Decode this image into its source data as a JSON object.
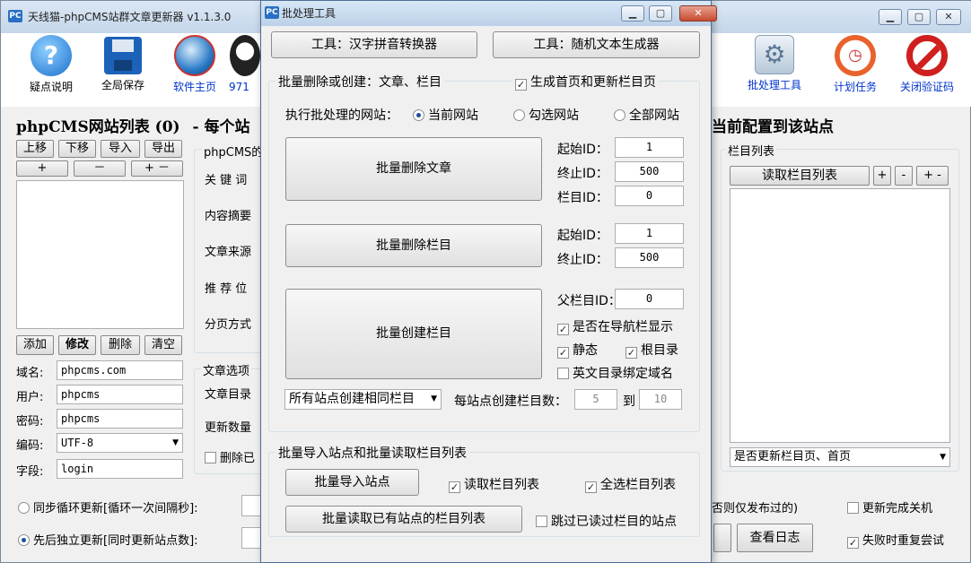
{
  "window": {
    "title": "天线猫-phpCMS站群文章更新器 v1.1.3.0",
    "icon": "PC"
  },
  "toolbar": [
    {
      "label": "疑点说明",
      "icon": "help-icon"
    },
    {
      "label": "全局保存",
      "icon": "save-disk-icon"
    },
    {
      "label": "软件主页",
      "icon": "globe-icon"
    },
    {
      "label": "971",
      "icon": "penguin-icon"
    },
    {
      "label": "批处理工具",
      "icon": "gear-cube-icon"
    },
    {
      "label": "计划任务",
      "icon": "clock-icon"
    },
    {
      "label": "关闭验证码",
      "icon": "no-entry-icon"
    }
  ],
  "left": {
    "site_list_title": "phpCMS网站列表 (0)",
    "heading_suffix": "- 每个站",
    "btn_up": "上移",
    "btn_down": "下移",
    "btn_import": "导入",
    "btn_export": "导出",
    "btn_plus": "+",
    "btn_minus": "－",
    "btn_plusminus": "+ －",
    "btn_add": "添加",
    "btn_edit": "修改",
    "btn_delete": "删除",
    "btn_clear": "清空",
    "domain_label": "域名:",
    "domain_value": "phpcms.com",
    "user_label": "用户:",
    "user_value": "phpcms",
    "pass_label": "密码:",
    "pass_value": "phpcms",
    "encoding_label": "编码:",
    "encoding_value": "UTF-8",
    "field_label": "字段:",
    "field_value": "login"
  },
  "middle": {
    "group_title": "phpCMS的",
    "keywords": "关 键 词",
    "summary": "内容摘要",
    "source": "文章来源",
    "recommend": "推 荐 位",
    "paging": "分页方式",
    "article_options": "文章选项",
    "article_dir": "文章目录",
    "update_count": "更新数量",
    "delete_label": "删除已"
  },
  "right": {
    "heading": "当前配置到该站点",
    "column_list_label": "栏目列表",
    "read_columns_btn": "读取栏目列表",
    "plus": "+",
    "minus": "-",
    "plusminus": "+ -",
    "update_select": "是否更新栏目页、首页"
  },
  "bottom": {
    "sync_loop": "同步循环更新[循环一次间隔秒]:",
    "independent": "先后独立更新[同时更新站点数]:",
    "else_only": "否则仅发布过的)",
    "shutdown": "更新完成关机",
    "retry": "失败时重复尝试",
    "view_log": "查看日志"
  },
  "dialog": {
    "title": "批处理工具",
    "tool_pinyin": "工具：汉字拼音转换器",
    "tool_random": "工具：随机文本生成器",
    "batch_section": "批量删除或创建：文章、栏目",
    "gen_index": "生成首页和更新栏目页",
    "exec_site_label": "执行批处理的网站：",
    "site_current": "当前网站",
    "site_checked": "勾选网站",
    "site_all": "全部网站",
    "del_article_btn": "批量删除文章",
    "start_id_label": "起始ID：",
    "start_id": "1",
    "end_id_label": "终止ID：",
    "end_id": "500",
    "column_id_label": "栏目ID：",
    "column_id": "0",
    "del_column_btn": "批量删除栏目",
    "start_id2": "1",
    "end_id2": "500",
    "create_column_btn": "批量创建栏目",
    "parent_id_label": "父栏目ID：",
    "parent_id": "0",
    "show_nav": "是否在导航栏显示",
    "static": "静态",
    "root_dir": "根目录",
    "en_dir_bind": "英文目录绑定域名",
    "same_columns_select": "所有站点创建相同栏目",
    "per_site_label": "每站点创建栏目数：",
    "per_site_from": "5",
    "to_label": "到",
    "per_site_to": "10",
    "import_section": "批量导入站点和批量读取栏目列表",
    "import_btn": "批量导入站点",
    "read_col_list": "读取栏目列表",
    "select_all_col": "全选栏目列表",
    "batch_read_btn": "批量读取已有站点的栏目列表",
    "skip_read": "跳过已读过栏目的站点"
  }
}
